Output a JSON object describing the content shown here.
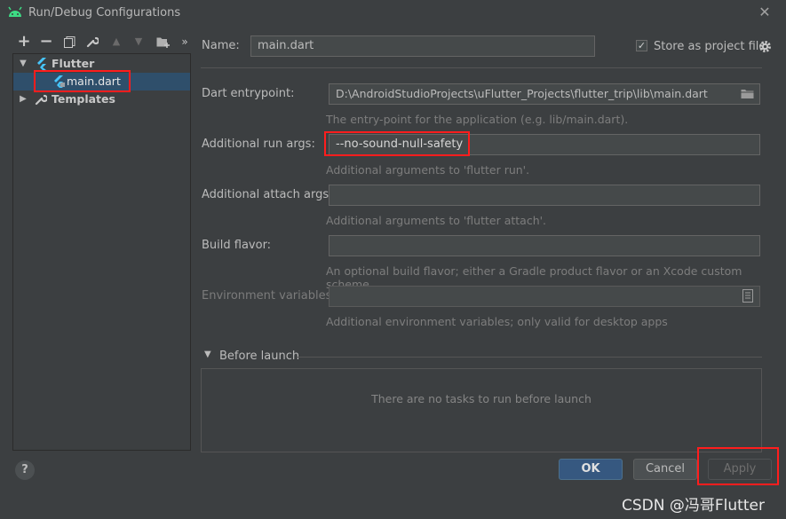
{
  "window": {
    "title": "Run/Debug Configurations",
    "close_glyph": "✕"
  },
  "toolbar": {
    "icons": [
      {
        "name": "add-icon",
        "glyph": "+"
      },
      {
        "name": "remove-icon",
        "glyph": "−"
      },
      {
        "name": "copy-icon",
        "glyph": "⧉"
      },
      {
        "name": "wrench-icon",
        "glyph": "🔧"
      },
      {
        "name": "move-up-icon",
        "glyph": "▲"
      },
      {
        "name": "move-down-icon",
        "glyph": "▼"
      },
      {
        "name": "new-folder-icon",
        "glyph": "▬"
      },
      {
        "name": "more-icon",
        "glyph": "»"
      }
    ]
  },
  "tree": {
    "flutter_label": "Flutter",
    "main_dart_label": "main.dart",
    "templates_label": "Templates"
  },
  "form": {
    "name_label": "Name:",
    "name_value": "main.dart",
    "store_label": "Store as project file",
    "store_checked": "✓",
    "entrypoint_label": "Dart entrypoint:",
    "entrypoint_value": "D:\\AndroidStudioProjects\\uFlutter_Projects\\flutter_trip\\lib\\main.dart",
    "entrypoint_hint": "The entry-point for the application (e.g. lib/main.dart).",
    "run_args_label": "Additional run args:",
    "run_args_value": "--no-sound-null-safety",
    "run_args_hint": "Additional arguments to 'flutter run'.",
    "attach_args_label": "Additional attach args:",
    "attach_args_value": "",
    "attach_args_hint": "Additional arguments to 'flutter attach'.",
    "flavor_label": "Build flavor:",
    "flavor_value": "",
    "flavor_hint": "An optional build flavor; either a Gradle product flavor or an Xcode custom scheme.",
    "env_label": "Environment variables:",
    "env_value": "",
    "env_hint": "Additional environment variables; only valid for desktop apps"
  },
  "before_launch": {
    "title": "Before launch",
    "empty_text": "There are no tasks to run before launch"
  },
  "buttons": {
    "help": "?",
    "ok": "OK",
    "cancel": "Cancel",
    "apply": "Apply"
  },
  "watermark": "CSDN @冯哥Flutter",
  "colors": {
    "background": "#3c3f41",
    "selection": "#2f4f6b",
    "highlight_box": "#ff1d1d",
    "ok_button": "#365880"
  }
}
